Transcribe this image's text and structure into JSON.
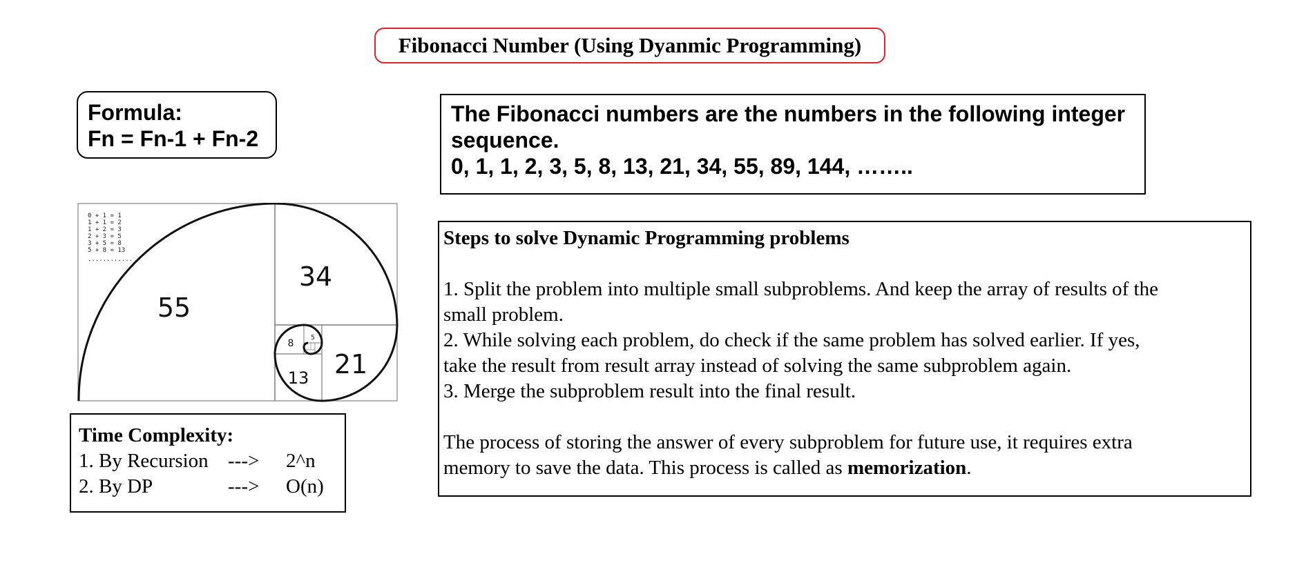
{
  "title": "Fibonacci Number (Using Dyanmic Programming)",
  "formula": {
    "label": "Formula:",
    "expression": "Fn = Fn-1 + Fn-2"
  },
  "description": {
    "line1": "The Fibonacci numbers are the numbers in the following integer",
    "line2": "sequence.",
    "sequence": "0, 1, 1, 2, 3, 5, 8, 13, 21, 34, 55, 89, 144, …….."
  },
  "spiral": {
    "sums": [
      "0 + 1 = 1",
      "1 + 1 = 2",
      "1 + 2 = 3",
      "2 + 3 = 5",
      "3 + 5 = 8",
      "5 + 8 = 13",
      "............"
    ],
    "squares": [
      "55",
      "34",
      "21",
      "13",
      "8",
      "5"
    ]
  },
  "steps": {
    "heading": "Steps to solve Dynamic Programming problems",
    "lines": [
      "1. Split the problem into multiple small subproblems. And keep the array of results of the",
      "small problem.",
      "2. While solving each problem, do check if the same problem has solved earlier. If yes,",
      "take the result from result array instead of solving the same subproblem again.",
      "3. Merge the subproblem result into the final result."
    ],
    "note_line1": "The process of storing the answer of every subproblem for future use, it requires extra",
    "note_line2_prefix": "memory to save the data. This process is called as ",
    "note_keyword": "memorization",
    "note_suffix": "."
  },
  "time_complexity": {
    "heading": "Time Complexity:",
    "rows": [
      {
        "label": "1. By Recursion",
        "arrow": "--->",
        "value": "2^n"
      },
      {
        "label": "2. By DP",
        "arrow": "--->",
        "value": "O(n)"
      }
    ]
  }
}
